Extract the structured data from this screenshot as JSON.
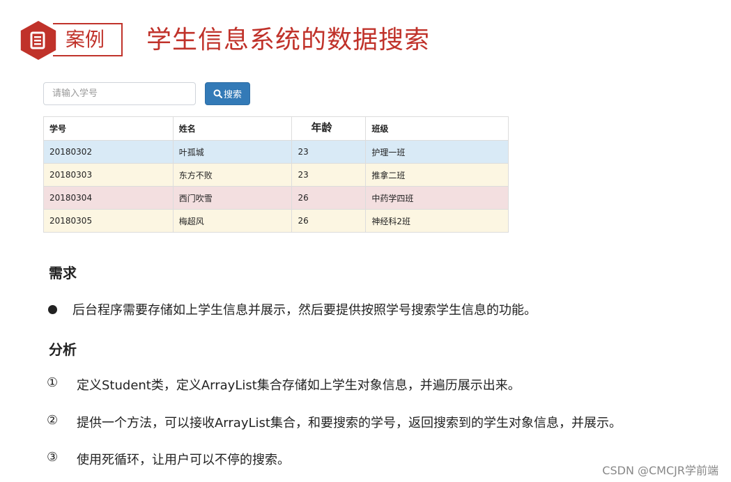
{
  "header": {
    "badge_label": "案例",
    "title": "学生信息系统的数据搜索",
    "accent_color": "#c0322a"
  },
  "search": {
    "placeholder": "请输入学号",
    "button_label": "搜索",
    "button_icon": "search-icon",
    "button_color": "#337ab7"
  },
  "table": {
    "headers": [
      "学号",
      "姓名",
      "年龄",
      "班级"
    ],
    "rows": [
      {
        "cells": [
          "20180302",
          "叶孤城",
          "23",
          "护理一班"
        ],
        "color": "#d9eaf6"
      },
      {
        "cells": [
          "20180303",
          "东方不败",
          "23",
          "推拿二班"
        ],
        "color": "#fcf6e2"
      },
      {
        "cells": [
          "20180304",
          "西门吹雪",
          "26",
          "中药学四班"
        ],
        "color": "#f3dfe0"
      },
      {
        "cells": [
          "20180305",
          "梅超风",
          "26",
          "神经科2班"
        ],
        "color": "#fcf6e2"
      }
    ]
  },
  "requirements": {
    "heading": "需求",
    "items": [
      "后台程序需要存储如上学生信息并展示，然后要提供按照学号搜索学生信息的功能。"
    ]
  },
  "analysis": {
    "heading": "分析",
    "items": [
      {
        "marker": "①",
        "text": "定义Student类，定义ArrayList集合存储如上学生对象信息，并遍历展示出来。"
      },
      {
        "marker": "②",
        "text": "提供一个方法，可以接收ArrayList集合，和要搜索的学号，返回搜索到的学生对象信息，并展示。"
      },
      {
        "marker": "③",
        "text": "使用死循环，让用户可以不停的搜索。"
      }
    ]
  },
  "watermark": "CSDN @CMCJR学前端"
}
